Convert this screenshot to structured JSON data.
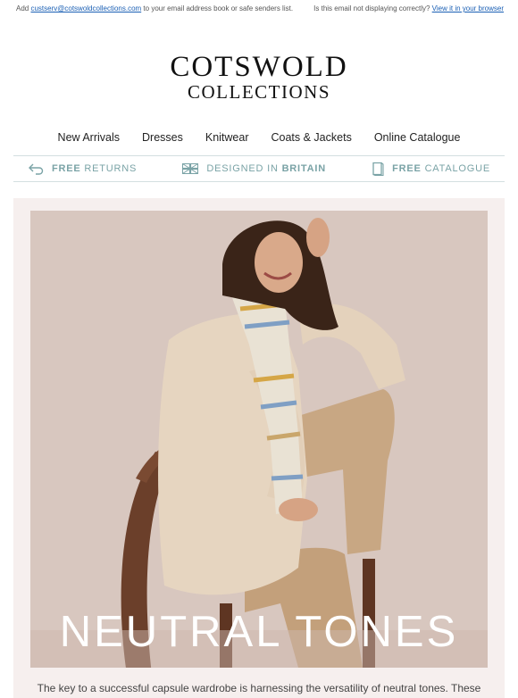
{
  "preheader": {
    "add_text": "Add",
    "email": "custserv@cotswoldcollections.com",
    "add_suffix": "to your email address book or safe senders list.",
    "display_question": "Is this email not displaying correctly?",
    "view_link": "View it in your browser"
  },
  "logo": {
    "line1": "COTSWOLD",
    "line2": "COLLECTIONS"
  },
  "nav": [
    "New Arrivals",
    "Dresses",
    "Knitwear",
    "Coats & Jackets",
    "Online Catalogue"
  ],
  "usp": {
    "returns_bold": "FREE",
    "returns_rest": "RETURNS",
    "designed_rest": "DESIGNED IN",
    "designed_bold": "BRITAIN",
    "catalogue_bold": "FREE",
    "catalogue_rest": "CATALOGUE",
    "icons": [
      "return-arrow-icon",
      "union-flag-icon",
      "catalogue-book-icon"
    ]
  },
  "hero": {
    "title": "NEUTRAL TONES"
  },
  "body": {
    "text": "The key to a successful capsule wardrobe is harnessing the versatility of neutral tones. These"
  },
  "colors": {
    "accent": "#7aa3a6",
    "hero_background": "#f6efee",
    "link": "#1a5fb4"
  }
}
